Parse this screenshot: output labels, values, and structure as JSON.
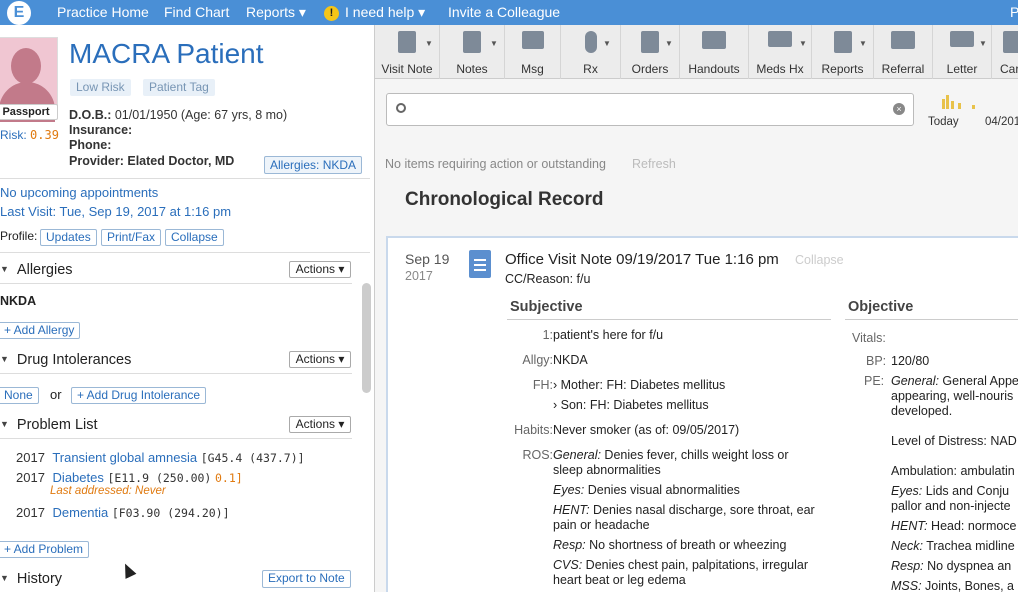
{
  "topbar": {
    "logo": "E",
    "nav": [
      "Practice Home",
      "Find Chart",
      "Reports ▾",
      "I need help ▾",
      "Invite a Colleague"
    ],
    "help_icon": "!",
    "right_letter": "P"
  },
  "patient": {
    "name": "MACRA Patient",
    "tags": [
      "Low Risk",
      "Patient Tag"
    ],
    "passport": "Passport",
    "risk_label": "Risk:",
    "risk_value": "0.39",
    "dob_label": "D.O.B.:",
    "dob": "01/01/1950 (Age: 67 yrs, 8 mo)",
    "insurance_label": "Insurance:",
    "phone_label": "Phone:",
    "provider_label": "Provider:",
    "provider": "Elated Doctor, MD",
    "allergies_badge": "Allergies: NKDA"
  },
  "appointments": {
    "upcoming": "No upcoming appointments",
    "last_visit": "Last Visit: Tue, Sep 19, 2017 at 1:16 pm"
  },
  "profile": {
    "label": "Profile:",
    "buttons": [
      "Updates",
      "Print/Fax",
      "Collapse"
    ]
  },
  "sections": {
    "allergies": {
      "title": "Allergies",
      "actions": "Actions ▾",
      "value": "NKDA",
      "add": "+ Add Allergy"
    },
    "drug_intolerances": {
      "title": "Drug Intolerances",
      "actions": "Actions ▾",
      "none": "None",
      "or": "or",
      "add": "+ Add Drug Intolerance"
    },
    "problem_list": {
      "title": "Problem List",
      "actions": "Actions ▾",
      "items": [
        {
          "year": "2017",
          "name": "Transient global amnesia",
          "code": "[G45.4 (437.7)]",
          "score": ""
        },
        {
          "year": "2017",
          "name": "Diabetes",
          "code": "[E11.9 (250.00)",
          "score": "0.1]"
        },
        {
          "year": "2017",
          "name": "Dementia",
          "code": "[F03.90 (294.20)]",
          "score": ""
        }
      ],
      "last_addressed": "Last addressed: Never",
      "add": "+ Add Problem"
    },
    "history": {
      "title": "History",
      "export": "Export to Note"
    }
  },
  "toolbar": {
    "items": [
      "Visit Note",
      "Notes",
      "Msg",
      "Rx",
      "Orders",
      "Handouts",
      "Meds Hx",
      "Reports",
      "Referral",
      "Letter",
      "Car"
    ]
  },
  "search": {
    "placeholder": ""
  },
  "timeline": {
    "today": "Today",
    "date": "04/201"
  },
  "feed": {
    "no_items": "No items requiring action or outstanding",
    "refresh": "Refresh",
    "heading": "Chronological Record"
  },
  "note": {
    "date": "Sep 19",
    "year": "2017",
    "title": "Office Visit Note 09/19/2017 Tue 1:16 pm",
    "collapse": "Collapse",
    "cc": "CC/Reason: f/u",
    "subjective_title": "Subjective",
    "objective_title": "Objective",
    "subjective": [
      {
        "key": "1:",
        "value": "patient's here for f/u"
      },
      {
        "key": "Allgy:",
        "value": "NKDA"
      },
      {
        "key": "FH:",
        "value": "› Mother: FH: Diabetes mellitus"
      },
      {
        "key": "",
        "value": "› Son: FH: Diabetes mellitus"
      },
      {
        "key": "Habits:",
        "value": "Never smoker (as of: 09/05/2017)"
      },
      {
        "key": "ROS:",
        "label": "General:",
        "value": " Denies fever, chills weight loss or sleep abnormalities"
      },
      {
        "key": "",
        "label": "Eyes:",
        "value": " Denies visual abnormalities"
      },
      {
        "key": "",
        "label": "HENT:",
        "value": " Denies nasal discharge, sore throat, ear pain or headache"
      },
      {
        "key": "",
        "label": "Resp:",
        "value": " No shortness of breath or wheezing"
      },
      {
        "key": "",
        "label": "CVS:",
        "value": " Denies chest pain, palpitations, irregular heart beat or leg edema"
      }
    ],
    "objective": [
      {
        "key": "Vitals:",
        "value": ""
      },
      {
        "key": "BP:",
        "value": "120/80"
      },
      {
        "key": "PE:",
        "label": "General:",
        "value": " General Appe appearing, well-nouris developed."
      },
      {
        "key": "",
        "value": "Level of Distress: NAD"
      },
      {
        "key": "",
        "value": "Ambulation: ambulatin"
      },
      {
        "key": "",
        "label": "Eyes:",
        "value": " Lids and Conju pallor and non-injecte"
      },
      {
        "key": "",
        "label": "HENT:",
        "value": " Head: normoce"
      },
      {
        "key": "",
        "label": "Neck:",
        "value": " Trachea midline"
      },
      {
        "key": "",
        "label": "Resp:",
        "value": " No dyspnea an"
      },
      {
        "key": "",
        "label": "MSS:",
        "value": " Joints, Bones, a"
      }
    ]
  }
}
